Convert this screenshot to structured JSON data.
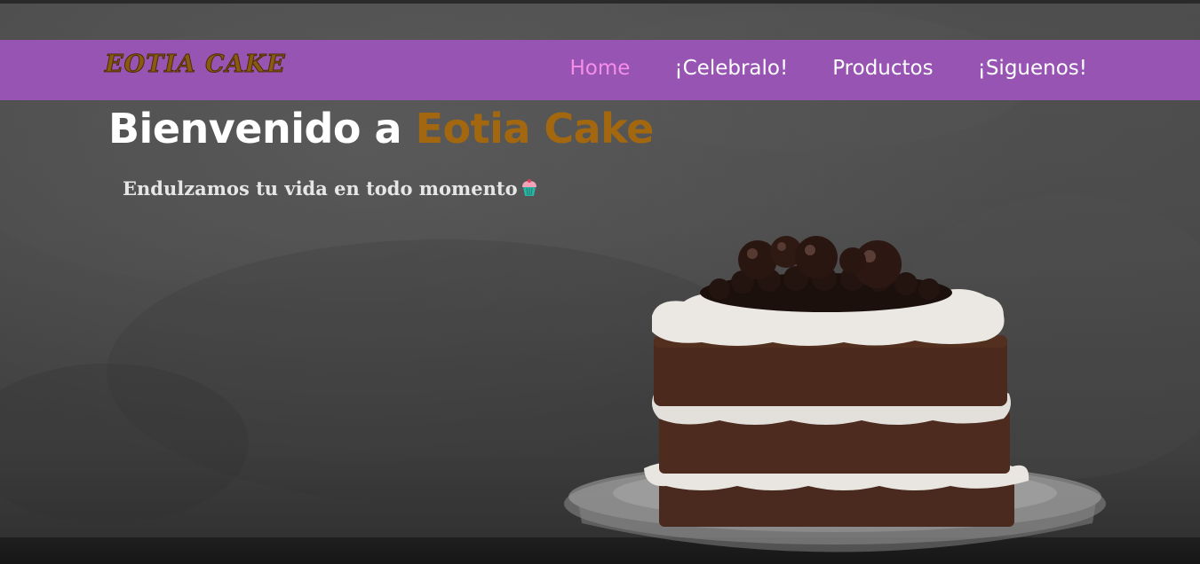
{
  "brand": {
    "logo_text": "EOTIA CAKE"
  },
  "nav": {
    "items": [
      {
        "label": "Home",
        "active": true
      },
      {
        "label": "¡Celebralo!",
        "active": false
      },
      {
        "label": "Productos",
        "active": false
      },
      {
        "label": "¡Siguenos!",
        "active": false
      }
    ]
  },
  "hero": {
    "title_prefix": "Bienvenido a ",
    "title_brand": "Eotia Cake",
    "subtitle": "Endulzamos tu vida en todo momento",
    "subtitle_icon": "cupcake-icon"
  },
  "colors": {
    "navbar": "#9754b3",
    "nav_active": "#f58ee8",
    "brand_accent": "#a3680f",
    "logo": "#8a5a12"
  },
  "illustration": {
    "icon": "chocolate-layer-cake-image"
  }
}
